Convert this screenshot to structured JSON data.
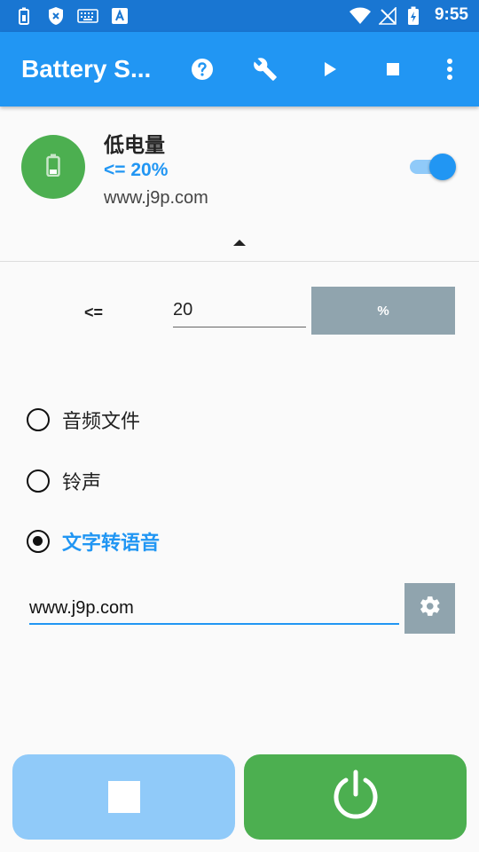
{
  "status_bar": {
    "time": "9:55",
    "icons": [
      "battery-saver-icon",
      "shield-icon",
      "keyboard-icon",
      "text-a-icon",
      "wifi-icon",
      "no-signal-icon",
      "battery-charging-icon"
    ]
  },
  "app_bar": {
    "title": "Battery S...",
    "actions": [
      "help-icon",
      "wrench-icon",
      "play-icon",
      "stop-icon",
      "more-vert-icon"
    ]
  },
  "profile": {
    "name": "低电量",
    "level": "<= 20%",
    "url": "www.j9p.com",
    "enabled": true
  },
  "threshold": {
    "operator": "<=",
    "value": "20",
    "unit": "%"
  },
  "alert_type": {
    "options": [
      {
        "label": "音频文件",
        "checked": false
      },
      {
        "label": "铃声",
        "checked": false
      },
      {
        "label": "文字转语音",
        "checked": true
      }
    ]
  },
  "tts": {
    "text": "www.j9p.com"
  },
  "colors": {
    "primary": "#2196f3",
    "primary_dark": "#1976d2",
    "green": "#4caf50",
    "grey_button": "#90a4ae",
    "light_blue": "#90caf9"
  }
}
